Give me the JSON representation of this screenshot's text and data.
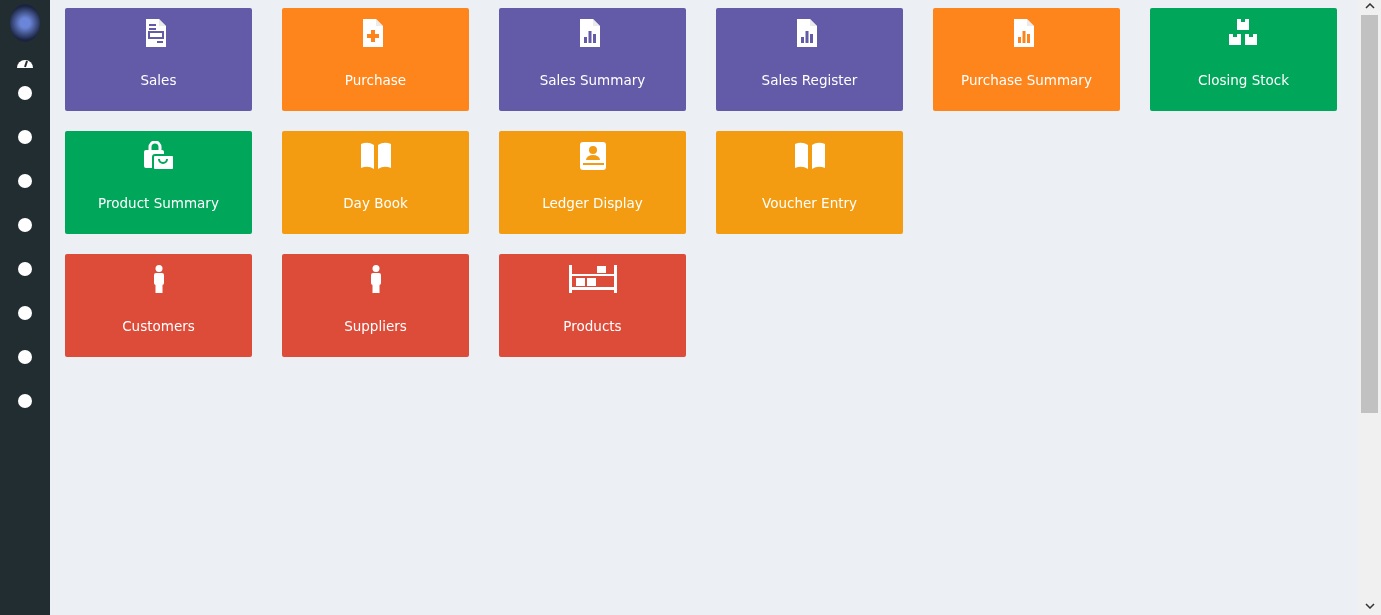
{
  "tile_rows": [
    [
      {
        "label": "Sales",
        "color": "#635ba8",
        "kind": "invoice"
      },
      {
        "label": "Purchase",
        "color": "#fd851b",
        "kind": "fileplus"
      },
      {
        "label": "Sales Summary",
        "color": "#635ba8",
        "kind": "report"
      },
      {
        "label": "Sales Register",
        "color": "#635ba8",
        "kind": "report"
      },
      {
        "label": "Purchase Summary",
        "color": "#fd851b",
        "kind": "report"
      },
      {
        "label": "Closing Stock",
        "color": "#00a65a",
        "kind": "stock"
      }
    ],
    [
      {
        "label": "Product Summary",
        "color": "#00a65a",
        "kind": "bags"
      },
      {
        "label": "Day Book",
        "color": "#f39c12",
        "kind": "book"
      },
      {
        "label": "Ledger Display",
        "color": "#f39c12",
        "kind": "ledger"
      },
      {
        "label": "Voucher Entry",
        "color": "#f39c12",
        "kind": "book"
      }
    ],
    [
      {
        "label": "Customers",
        "color": "#dd4b39",
        "kind": "person"
      },
      {
        "label": "Suppliers",
        "color": "#dd4b39",
        "kind": "person"
      },
      {
        "label": "Products",
        "color": "#dd4b39",
        "kind": "shelf"
      }
    ]
  ]
}
